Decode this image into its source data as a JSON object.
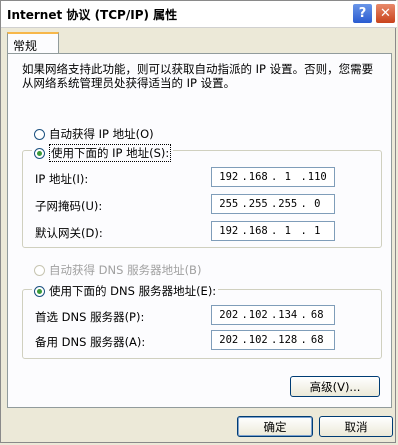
{
  "window": {
    "title": "Internet 协议 (TCP/IP) 属性",
    "help_label": "?",
    "close_label": "✕"
  },
  "tabs": [
    {
      "label": "常规"
    }
  ],
  "description": "如果网络支持此功能，则可以获取自动指派的 IP 设置。否则，您需要从网络系统管理员处获得适当的 IP 设置。",
  "ip_section": {
    "auto_label": "自动获得 IP 地址(O)",
    "manual_label": "使用下面的 IP 地址(S):",
    "fields": [
      {
        "label": "IP 地址(I):",
        "octets": [
          "192",
          "168",
          "1",
          "110"
        ]
      },
      {
        "label": "子网掩码(U):",
        "octets": [
          "255",
          "255",
          "255",
          "0"
        ]
      },
      {
        "label": "默认网关(D):",
        "octets": [
          "192",
          "168",
          "1",
          "1"
        ]
      }
    ]
  },
  "dns_section": {
    "auto_label": "自动获得 DNS 服务器地址(B)",
    "manual_label": "使用下面的 DNS 服务器地址(E):",
    "fields": [
      {
        "label": "首选 DNS 服务器(P):",
        "octets": [
          "202",
          "102",
          "134",
          "68"
        ]
      },
      {
        "label": "备用 DNS 服务器(A):",
        "octets": [
          "202",
          "102",
          "128",
          "68"
        ]
      }
    ]
  },
  "buttons": {
    "advanced": "高级(V)...",
    "ok": "确定",
    "cancel": "取消"
  }
}
